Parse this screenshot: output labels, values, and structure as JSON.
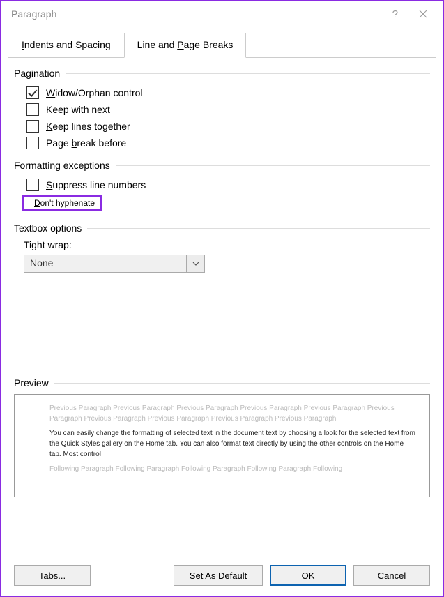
{
  "window": {
    "title": "Paragraph"
  },
  "tabs": {
    "inactive": "Indents and Spacing",
    "active": "Line and Page Breaks"
  },
  "pagination": {
    "header": "Pagination",
    "widow": "Widow/Orphan control",
    "keepnext": "Keep with next",
    "keeplines": "Keep lines together",
    "pagebreak": "Page break before"
  },
  "formatting": {
    "header": "Formatting exceptions",
    "suppress": "Suppress line numbers",
    "dont_hyphenate": "Don't hyphenate"
  },
  "textbox": {
    "header": "Textbox options",
    "tightwrap_label": "Tight wrap:",
    "tightwrap_value": "None"
  },
  "preview": {
    "header": "Preview",
    "prev_text": "Previous Paragraph Previous Paragraph Previous Paragraph Previous Paragraph Previous Paragraph Previous Paragraph Previous Paragraph Previous Paragraph Previous Paragraph Previous Paragraph",
    "body_text": "You can easily change the formatting of selected text in the document text by choosing a look for the selected text from the Quick Styles gallery on the Home tab. You can also format text directly by using the other controls on the Home tab. Most control",
    "next_text": "Following Paragraph Following Paragraph Following Paragraph Following Paragraph Following"
  },
  "buttons": {
    "tabs": "Tabs...",
    "setdefault": "Set As Default",
    "ok": "OK",
    "cancel": "Cancel"
  }
}
